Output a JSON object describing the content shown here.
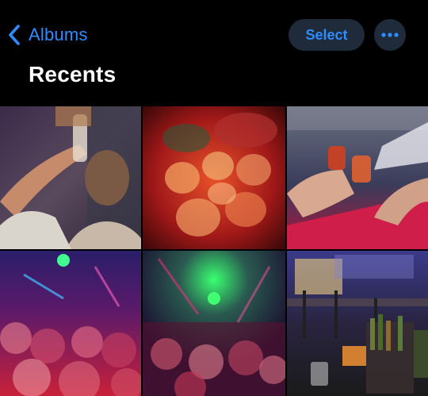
{
  "nav": {
    "back_label": "Albums",
    "select_label": "Select"
  },
  "header": {
    "title": "Recents"
  },
  "colors": {
    "accent": "#2d8cff",
    "pill_bg": "#1f2a3a",
    "background": "#000000"
  },
  "icons": {
    "back": "chevron-left-icon",
    "more": "ellipsis-icon"
  },
  "grid": {
    "photos": [
      {
        "id": "photo-1",
        "description": "person drinking in club"
      },
      {
        "id": "photo-2",
        "description": "shot glasses on red bar"
      },
      {
        "id": "photo-3",
        "description": "hands toasting shots at bar"
      },
      {
        "id": "photo-4",
        "description": "crowd under colorful lights"
      },
      {
        "id": "photo-5",
        "description": "green and pink stage lights over crowd"
      },
      {
        "id": "photo-6",
        "description": "bar tables with bottles and stage"
      }
    ]
  }
}
